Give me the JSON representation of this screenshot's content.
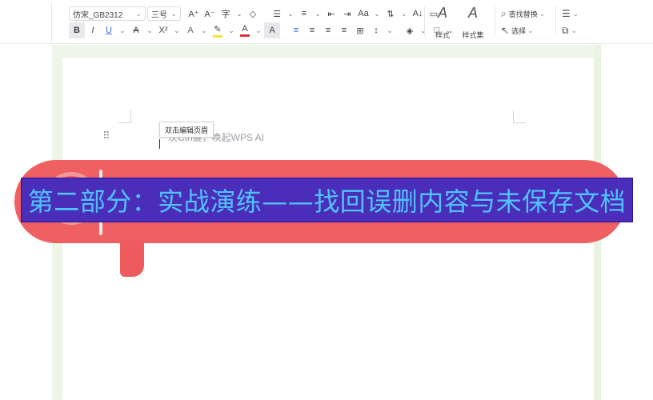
{
  "ribbon": {
    "font_family_value": "仿宋_GB2312",
    "font_size_value": "三号",
    "row1_tools": [
      {
        "name": "increase-font-icon",
        "glyph": "A⁺"
      },
      {
        "name": "decrease-font-icon",
        "glyph": "A⁻"
      },
      {
        "name": "phonetic-guide-icon",
        "glyph": "字"
      },
      {
        "name": "clear-format-icon",
        "glyph": "◇"
      },
      {
        "name": "bullets-icon",
        "glyph": "☰"
      },
      {
        "name": "numbering-icon",
        "glyph": "≡"
      },
      {
        "name": "decrease-indent-icon",
        "glyph": "⇤"
      },
      {
        "name": "increase-indent-icon",
        "glyph": "⇥"
      },
      {
        "name": "change-case-icon",
        "glyph": "Aa"
      },
      {
        "name": "text-direction-icon",
        "glyph": "⇅"
      },
      {
        "name": "sort-icon",
        "glyph": "A↓"
      },
      {
        "name": "show-hide-marks-icon",
        "glyph": "▭"
      }
    ],
    "row2_tools": [
      {
        "name": "bold-icon",
        "glyph": "B"
      },
      {
        "name": "italic-icon",
        "glyph": "I"
      },
      {
        "name": "underline-icon",
        "glyph": "U"
      },
      {
        "name": "strikethrough-icon",
        "glyph": "A"
      },
      {
        "name": "superscript-icon",
        "glyph": "X²"
      },
      {
        "name": "text-effect-icon",
        "glyph": "A"
      },
      {
        "name": "highlight-icon",
        "glyph": "✎"
      },
      {
        "name": "font-color-icon",
        "glyph": "A"
      },
      {
        "name": "char-shading-icon",
        "glyph": "A"
      },
      {
        "name": "align-left-icon",
        "glyph": "≡"
      },
      {
        "name": "align-center-icon",
        "glyph": "≡"
      },
      {
        "name": "align-right-icon",
        "glyph": "≡"
      },
      {
        "name": "justify-icon",
        "glyph": "≡"
      },
      {
        "name": "distribute-icon",
        "glyph": "⊞"
      },
      {
        "name": "line-spacing-icon",
        "glyph": "↕"
      },
      {
        "name": "shading-icon",
        "glyph": "◈"
      },
      {
        "name": "border-icon",
        "glyph": "□"
      }
    ],
    "styles_label": "样式",
    "style_set_label": "样式集",
    "find_replace_label": "查找替换",
    "select_label": "选择"
  },
  "document": {
    "header_tooltip": "双击编辑页眉",
    "ai_hint": "次Ctrl键，唤起WPS AI"
  },
  "overlay": {
    "title": "第二部分：实战演练——找回误删内容与未保存文档"
  },
  "colors": {
    "bubble": "#ee5b5e",
    "banner_bg": "#4a2db8",
    "banner_text": "#4fc4ff",
    "canvas_bg": "#eef6ea"
  }
}
